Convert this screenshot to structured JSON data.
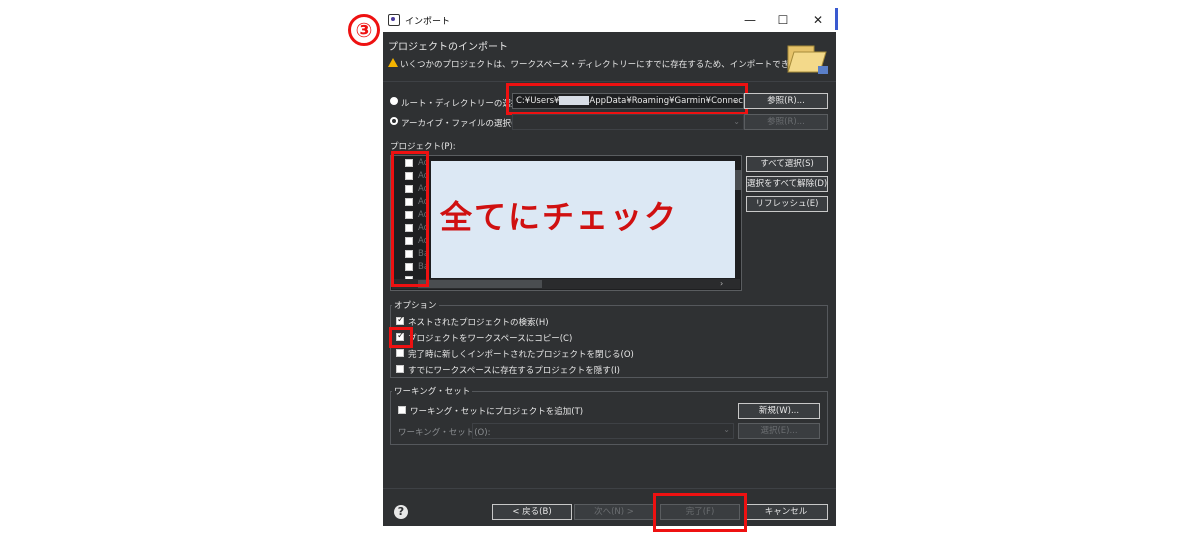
{
  "step_marker": "③",
  "window": {
    "title": "インポート",
    "minimize": "—",
    "maximize": "☐",
    "close": "✕"
  },
  "header": {
    "title": "プロジェクトのインポート",
    "warning": "いくつかのプロジェクトは、ワークスペース・ディレクトリーにすでに存在するため、インポートできません"
  },
  "source": {
    "root_dir_label": "ルート・ディレクトリーの選択(T):",
    "root_path_prefix": "C:¥Users¥",
    "root_path_suffix": "AppData¥Roaming¥Garmin¥Connec",
    "browse_label": "参照(R)...",
    "archive_label": "アーカイブ・ファイルの選択(A):",
    "browse2_label": "参照(R)..."
  },
  "projects": {
    "label": "プロジェクト(P):",
    "items": [
      "Ac",
      "Ac",
      "Ac",
      "Ac",
      "Ac",
      "Ac",
      "Ac",
      "Ba",
      "Ba",
      "Co"
    ],
    "select_all": "すべて選択(S)",
    "deselect_all": "選択をすべて解除(D)",
    "refresh": "リフレッシュ(E)"
  },
  "annotation": {
    "overlay_text": "全てにチェック"
  },
  "options": {
    "label": "オプション",
    "items": [
      {
        "label": "ネストされたプロジェクトの検索(H)",
        "checked": true
      },
      {
        "label": "プロジェクトをワークスペースにコピー(C)",
        "checked": true
      },
      {
        "label": "完了時に新しくインポートされたプロジェクトを閉じる(O)",
        "checked": false
      },
      {
        "label": "すでにワークスペースに存在するプロジェクトを隠す(I)",
        "checked": false
      }
    ]
  },
  "working_set": {
    "label": "ワーキング・セット",
    "add_label": "ワーキング・セットにプロジェクトを追加(T)",
    "new_label": "新規(W)...",
    "set_label": "ワーキング・セット(O):",
    "select_label": "選択(E)..."
  },
  "footer": {
    "help": "?",
    "back": "< 戻る(B)",
    "next": "次へ(N) >",
    "finish": "完了(F)",
    "cancel": "キャンセル"
  }
}
